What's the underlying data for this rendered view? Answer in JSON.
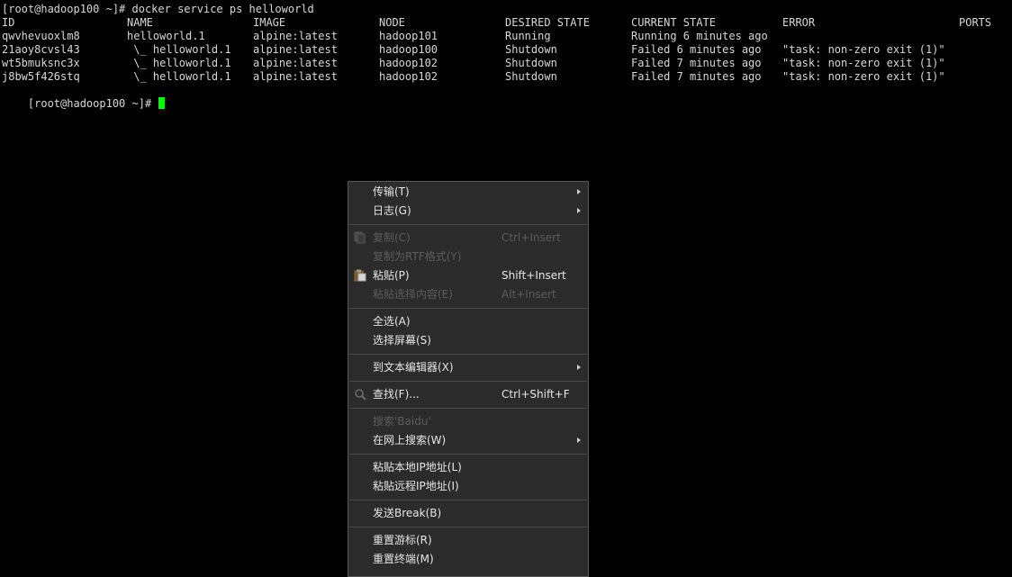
{
  "terminal": {
    "command_line": "[root@hadoop100 ~]# docker service ps helloworld",
    "prompt": "[root@hadoop100 ~]# ",
    "headers": {
      "id": "ID",
      "name": "NAME",
      "image": "IMAGE",
      "node": "NODE",
      "desired": "DESIRED STATE",
      "current": "CURRENT STATE",
      "error": "ERROR",
      "ports": "PORTS"
    },
    "rows": [
      {
        "id": "qwvhevuoxlm8",
        "name": "helloworld.1",
        "image": "alpine:latest",
        "node": "hadoop101",
        "desired": "Running",
        "current": "Running 6 minutes ago",
        "error": ""
      },
      {
        "id": "21aoy8cvsl43",
        "name": " \\_ helloworld.1",
        "image": "alpine:latest",
        "node": "hadoop100",
        "desired": "Shutdown",
        "current": "Failed 6 minutes ago",
        "error": "\"task: non-zero exit (1)\""
      },
      {
        "id": "wt5bmuksnc3x",
        "name": " \\_ helloworld.1",
        "image": "alpine:latest",
        "node": "hadoop102",
        "desired": "Shutdown",
        "current": "Failed 7 minutes ago",
        "error": "\"task: non-zero exit (1)\""
      },
      {
        "id": "j8bw5f426stq",
        "name": " \\_ helloworld.1",
        "image": "alpine:latest",
        "node": "hadoop102",
        "desired": "Shutdown",
        "current": "Failed 7 minutes ago",
        "error": "\"task: non-zero exit (1)\""
      }
    ],
    "colors": {
      "background": "#000000",
      "text": "#d8d8d8",
      "cursor": "#00ff00"
    }
  },
  "context_menu": {
    "transfer": "传输(T)",
    "log": "日志(G)",
    "copy": {
      "label": "复制(C)",
      "shortcut": "Ctrl+Insert"
    },
    "copy_rtf": "复制为RTF格式(Y)",
    "paste": {
      "label": "粘贴(P)",
      "shortcut": "Shift+Insert"
    },
    "paste_selection": {
      "label": "粘贴选择内容(E)",
      "shortcut": "Alt+Insert"
    },
    "select_all": "全选(A)",
    "select_screen": "选择屏幕(S)",
    "to_text_editor": "到文本编辑器(X)",
    "find": {
      "label": "查找(F)...",
      "shortcut": "Ctrl+Shift+F"
    },
    "search_baidu": "搜索'Baidu'",
    "search_web": "在网上搜索(W)",
    "paste_local_ip": "粘贴本地IP地址(L)",
    "paste_remote_ip": "粘贴远程IP地址(I)",
    "send_break": "发送Break(B)",
    "reset_cursor": "重置游标(R)",
    "reset_terminal": "重置终端(M)",
    "colors": {
      "background": "#2b2b2b",
      "text": "#e6e6e6",
      "disabled_text": "#5c5c5c",
      "separator": "#4a4a4a"
    }
  }
}
